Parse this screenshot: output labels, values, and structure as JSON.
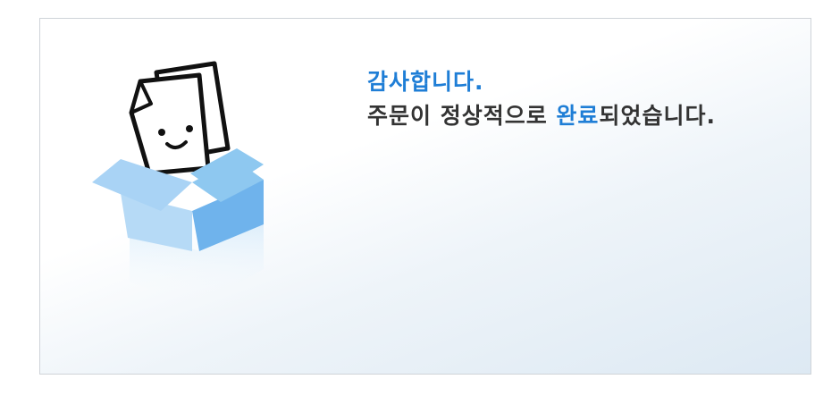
{
  "message": {
    "thanks": "감사합니다.",
    "order_prefix": "주문이 정상적으로 ",
    "order_highlight": "완료",
    "order_suffix": "되었습니다."
  },
  "icons": {
    "illustration": "document-in-box-icon"
  },
  "colors": {
    "accent": "#1f7ed6",
    "text": "#333333",
    "box_light": "#a9d3f5",
    "box_dark": "#6fb3ec"
  }
}
